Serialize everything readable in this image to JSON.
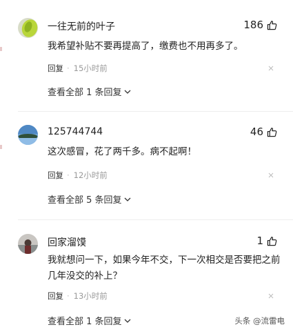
{
  "comments": [
    {
      "username": "一往无前的叶子",
      "likes": "186",
      "content": "我希望补贴不要再提高了，缴费也不用再多了。",
      "reply_label": "回复",
      "time": "15小时前",
      "view_replies": "查看全部 1 条回复"
    },
    {
      "username": "125744744",
      "likes": "46",
      "content": "这次感冒，花了两千多。病不起啊！",
      "reply_label": "回复",
      "time": "12小时前",
      "view_replies": "查看全部 5 条回复"
    },
    {
      "username": "回家溜馍",
      "likes": "1",
      "content": "我就想问一下，如果今年不交，下一次相交是否要把之前几年没交的补上？",
      "reply_label": "回复",
      "time": "13小时前",
      "view_replies": "查看全部 1 条回复"
    }
  ],
  "watermark": "头条 @流雷电",
  "icons": {
    "like": "thumbs-up-icon",
    "close": "close-icon",
    "expand": "chevron-down-icon"
  }
}
